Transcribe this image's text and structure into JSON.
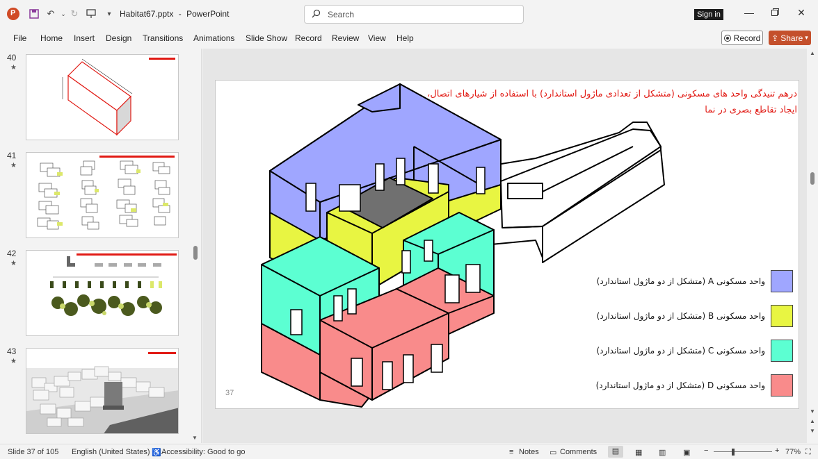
{
  "titlebar": {
    "filename": "Habitat67.pptx",
    "app_sep": "-",
    "app": "PowerPoint",
    "search_placeholder": "Search",
    "signin": "Sign in"
  },
  "ribbon": {
    "tabs": [
      "File",
      "Home",
      "Insert",
      "Design",
      "Transitions",
      "Animations",
      "Slide Show",
      "Record",
      "Review",
      "View",
      "Help"
    ],
    "record_btn": "Record",
    "share_btn": "Share"
  },
  "thumbnails": [
    {
      "num": "40",
      "star": "★"
    },
    {
      "num": "41",
      "star": "★"
    },
    {
      "num": "42",
      "star": "★"
    },
    {
      "num": "43",
      "star": "★"
    }
  ],
  "slide": {
    "title_line1": "درهم تنیدگی واحد های مسکونی (متشکل از تعدادی ماژول استاندارد) با استفاده از شیارهای اتصال،",
    "title_line2": "ایجاد تقاطع بصری در نما",
    "number": "37",
    "legend": [
      {
        "text": "واحد مسکونی A  (متشکل از دو ماژول استاندارد)",
        "color": "#9fa6ff"
      },
      {
        "text": "واحد مسکونی B  (متشکل از دو ماژول استاندارد)",
        "color": "#e8f542"
      },
      {
        "text": "واحد مسکونی C  (متشکل از دو ماژول استاندارد)",
        "color": "#5cffd2"
      },
      {
        "text": "واحد مسکونی D  (متشکل از دو ماژول استاندارد)",
        "color": "#f98b8b"
      }
    ]
  },
  "statusbar": {
    "slide_info": "Slide 37 of 105",
    "language": "English (United States)",
    "accessibility": "Accessibility: Good to go",
    "notes": "Notes",
    "comments": "Comments",
    "zoom": "77%",
    "zoom_minus": "−",
    "zoom_plus": "+"
  },
  "colors": {
    "unit_a": "#9fa6ff",
    "unit_b": "#e8f542",
    "unit_c": "#5cffd2",
    "unit_d": "#f98b8b",
    "title_red": "#e11a14",
    "share": "#c4502c"
  }
}
